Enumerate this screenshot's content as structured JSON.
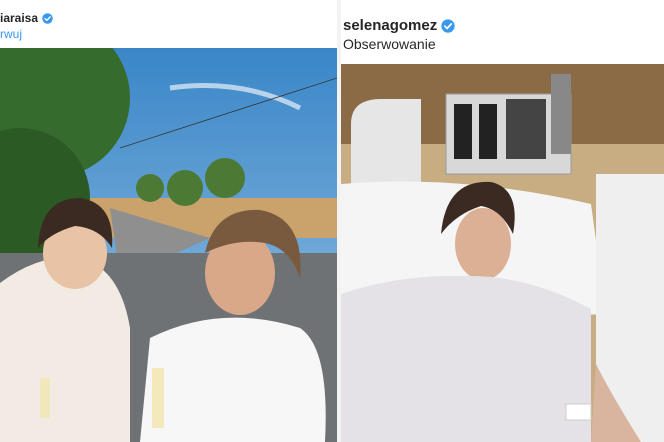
{
  "left_post": {
    "username": "iaraisa",
    "follow_label": "rwuj",
    "photo_icon": "photo-two-women-champagne"
  },
  "right_post": {
    "username": "selenagomez",
    "follow_label": "Obserwowanie",
    "photo_icon": "photo-hospital-room"
  },
  "icons": {
    "verified": "verified-badge-icon",
    "instagram": "instagram-glyph-icon"
  },
  "colors": {
    "verified_blue": "#3897f0",
    "follow_link_blue": "#3897f0",
    "username_text": "#262626"
  }
}
